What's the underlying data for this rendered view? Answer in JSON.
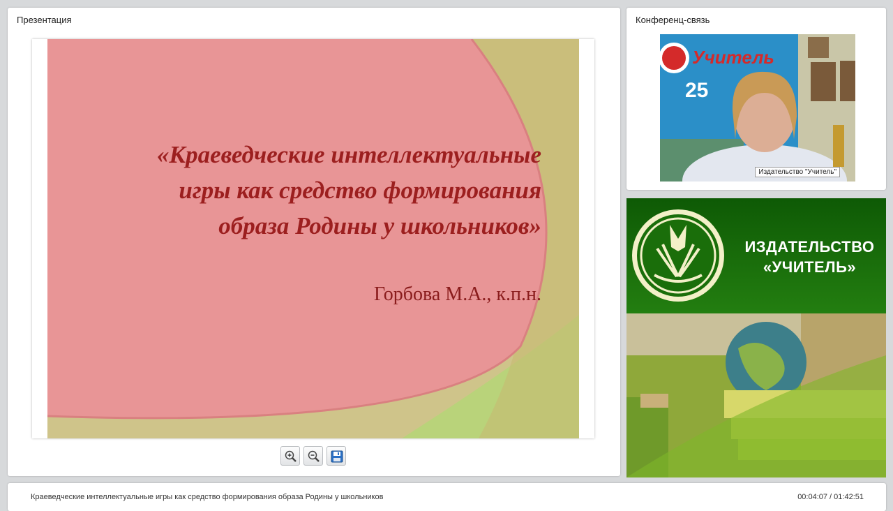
{
  "presentation": {
    "title": "Презентация",
    "slide": {
      "title_lines": [
        "«Краеведческие интеллектуальные",
        "игры как средство формирования",
        "образа Родины у школьников»"
      ],
      "author": "Горбова М.А., к.п.н."
    },
    "toolbar": {
      "zoom_in_icon": "zoom-in-icon",
      "zoom_out_icon": "zoom-out-icon",
      "save_icon": "floppy-disk-icon"
    }
  },
  "conference": {
    "title": "Конференц-связь",
    "video": {
      "caption": "Издательство \"Учитель\"",
      "poster_text": "Учитель"
    }
  },
  "banner": {
    "name_line1": "ИЗДАТЕЛЬСТВО",
    "name_line2": "«УЧИТЕЛЬ»"
  },
  "status": {
    "title": "Краеведческие интеллектуальные игры как средство формирования образа Родины у школьников",
    "time": "00:04:07 / 01:42:51"
  }
}
